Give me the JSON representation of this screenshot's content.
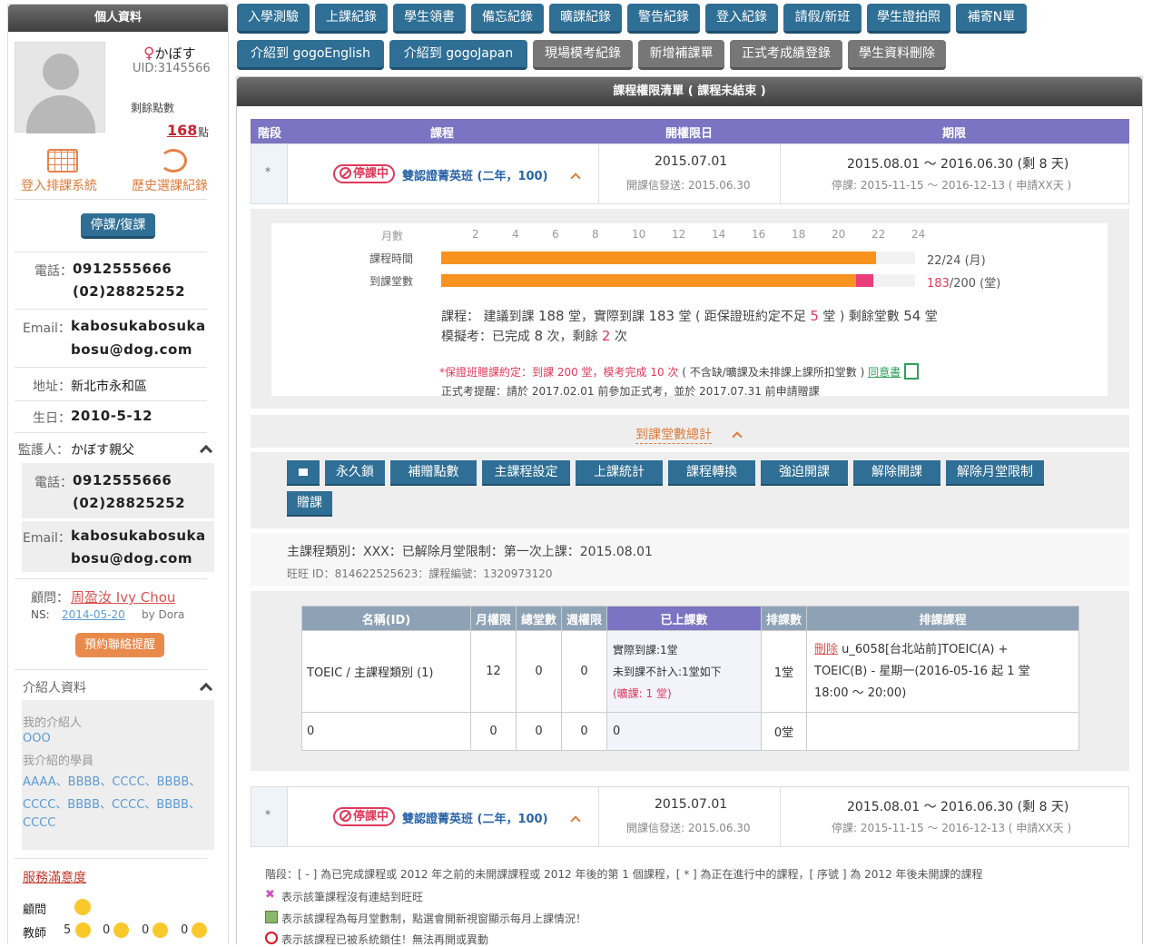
{
  "sidebar": {
    "title": "個人資料",
    "name": "かぼす",
    "uid": "UID:3145566",
    "points_label": "剩餘點數",
    "points_value": "168",
    "points_unit": "點",
    "login_schedule": "登入排課系統",
    "history": "歷史選課紀錄",
    "suspend_btn": "停課/復課",
    "phone_label": "電話：",
    "phone1": "0912555666",
    "phone2": "(02)28825252",
    "email_label": "Email：",
    "email1": "kabosukabosuka",
    "email2": "bosu@dog.com",
    "address_label": "地址：",
    "address": "新北市永和區",
    "birthday_label": "生日：",
    "birthday": "2010-5-12",
    "guardian_label": "監護人：",
    "guardian": "かぼす親父",
    "g_phone_label": "電話：",
    "g_phone1": "0912555666",
    "g_phone2": "(02)28825252",
    "g_email_label": "Email：",
    "g_email1": "kabosukabosuka",
    "g_email2": "bosu@dog.com",
    "advisor_label": "顧問：",
    "advisor": "周盈汝 Ivy Chou",
    "ns_label": "NS:",
    "ns_date": "2014-05-20",
    "ns_by": "by Dora",
    "remind_btn": "預約聯絡提醒",
    "referrer_title": "介紹人資料",
    "my_referrer": "我的介紹人",
    "my_referrer_val": "OOO",
    "my_students": "我介紹的學員",
    "students_line1": "AAAA、BBBB、CCCC、BBBB、",
    "students_line2": "CCCC、BBBB、CCCC、BBBB、",
    "students_line3": "CCCC",
    "satisfaction": "服務滿意度",
    "consultant": "顧問",
    "teacher": "教師",
    "teacher_counts": [
      "5",
      "0",
      "0",
      "0"
    ]
  },
  "toolbar": {
    "row1": [
      "入學測驗",
      "上課紀錄",
      "學生領書",
      "備忘紀錄",
      "曠課紀錄",
      "警告紀錄",
      "登入紀錄",
      "請假/新班",
      "學生證拍照",
      "補寄N單"
    ],
    "row2": [
      "介紹到 gogoEnglish",
      "介紹到 gogoJapan",
      "現場模考紀錄",
      "新增補課單",
      "正式考成績登錄",
      "學生資料刪除"
    ]
  },
  "main": {
    "title": "課程權限清單 ( 課程未結束 )",
    "headers": [
      "階段",
      "課程",
      "開權限日",
      "期限"
    ],
    "course": {
      "stage": "*",
      "status": "停課中",
      "name": "雙認證菁英班 (二年，100)",
      "open_date": "2015.07.01",
      "open_mail": "開課信發送: 2015.06.30",
      "period": "2015.08.01 ～ 2016.06.30 (剩 8 天)",
      "suspend": "停課: 2015-11-15 ～ 2016-12-13 ( 申請XX天 )"
    },
    "progress": {
      "month_label": "月數",
      "ticks": [
        "2",
        "4",
        "6",
        "8",
        "10",
        "12",
        "14",
        "16",
        "18",
        "20",
        "22",
        "24"
      ],
      "row1_label": "課程時間",
      "row1_value": "22/24 (月)",
      "row1_fraction": 0.917,
      "row2_label": "到課堂數",
      "row2_value_a": "183",
      "row2_value_b": "/200 (堂)",
      "row2_fraction": 0.876,
      "row2_extra_fraction": 0.036
    },
    "summary": {
      "line1_a": "課程： 建議到課",
      "line1_b": "188",
      "line1_c": "堂，實際到課",
      "line1_d": "183",
      "line1_e": "堂 ( 距保證班約定不足",
      "line1_f": "5",
      "line1_g": "堂 ) 剩餘堂數",
      "line1_h": "54",
      "line1_i": "堂",
      "line2_a": "模擬考：已完成",
      "line2_b": "8",
      "line2_c": "次，剩餘",
      "line2_d": "2",
      "line2_e": "次",
      "note_red": "*保證班贈課約定：到課 200 堂，模考完成 10 次",
      "note_rest": "( 不含缺/曠課及未排課上課所扣堂數 )",
      "agree": "同意書",
      "exam_reminder": "正式考提醒：請於 2017.02.01 前參加正式考，並於 2017.07.31 前申請贈課"
    },
    "attendance_total": "到課堂數總計",
    "actions": [
      "永久鎖",
      "補贈點數",
      "主課程設定",
      "上課統計",
      "課程轉換",
      "強迫開課",
      "解除開課",
      "解除月堂限制"
    ],
    "action_gift": "贈課",
    "main_course_type": "主課程類別：XXX：已解除月堂限制：第一次上課：2015.08.01",
    "wangwang": "旺旺 ID：814622525623：課程編號：1320973120",
    "table": {
      "headers": [
        "名稱(ID)",
        "月權限",
        "總堂數",
        "週權限",
        "已上課數",
        "排課數",
        "排課課程"
      ],
      "row1": {
        "name": "TOEIC / 主課程類別 (1)",
        "month": "12",
        "total": "0",
        "week": "0",
        "taken1": "實際到課:1堂",
        "taken2": "未到課不計入:1堂如下",
        "taken3": "(曠課: 1 堂)",
        "scheduled": "1堂",
        "course_del": "刪除",
        "course_text1": "u_6058[台北站前]TOEIC(A) +",
        "course_text2": "TOEIC(B) - 星期一(2016-05-16 起 1 堂",
        "course_text3": "18:00 ～ 20:00)"
      },
      "row2": {
        "name": "0",
        "month": "0",
        "total": "0",
        "week": "0",
        "taken": "0",
        "scheduled": "0堂"
      }
    },
    "course2": {
      "stage": "*",
      "status": "停課中",
      "name": "雙認證菁英班 (二年，100)",
      "open_date": "2015.07.01",
      "open_mail": "開課信發送: 2015.06.30",
      "period": "2015.08.01 ～ 2016.06.30 (剩 8 天)",
      "suspend": "停課: 2015-11-15 ～ 2016-12-13 ( 申請XX天 )"
    },
    "legend": {
      "stage_note": "階段：[ - ] 為已完成課程或 2012 年之前的未開課課程或 2012 年後的第 1 個課程，[ * ] 為正在進行中的課程，[ 序號 ] 為 2012 年後未開課的課程",
      "note1": "表示該筆課程沒有連結到旺旺",
      "note2": "表示該課程為每月堂數制，點選會開新視窗顯示每月上課情況！",
      "note3": "表示該課程已被系統鎖住！無法再開或異動"
    }
  },
  "colors": {
    "purple_header": "#7b74c2",
    "dark_blue_button": "#2f6f95",
    "orange_bar": "#f7931e",
    "pink_bar": "#e93e78",
    "red_text": "#e0395a"
  }
}
